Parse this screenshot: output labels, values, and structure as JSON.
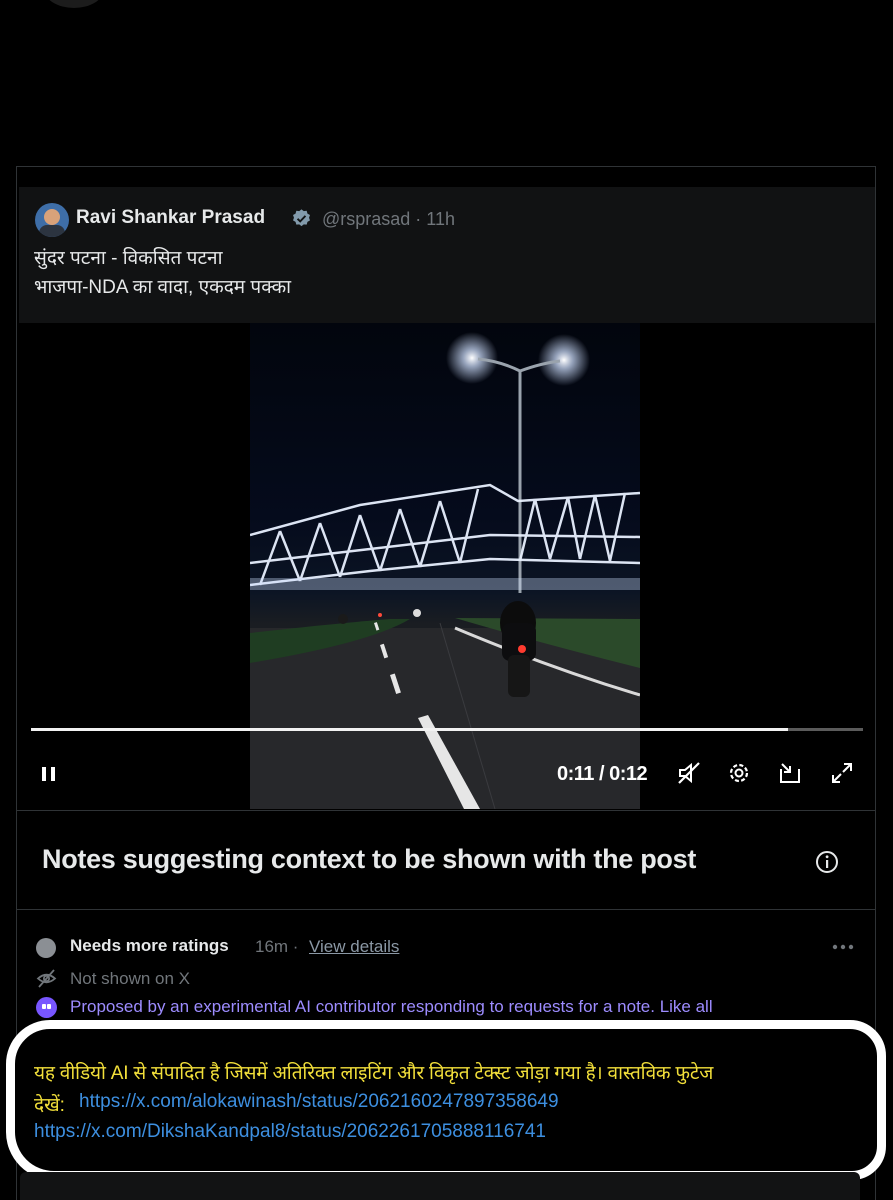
{
  "quote": {
    "author": "Ravi Shankar Prasad",
    "handle_time": "@rsprasad · 11h",
    "line1": "सुंदर पटना - विकसित पटना",
    "line2": "भाजपा-NDA का वादा, एकदम पक्का"
  },
  "video": {
    "time": "0:11 / 0:12",
    "progress": 0.91
  },
  "notes": {
    "title": "Notes suggesting context to be shown with the post",
    "status": "Needs more ratings",
    "status_time": "16m ·",
    "view_details": "View details",
    "not_shown": "Not shown on X",
    "ai_proposed": "Proposed by an experimental AI contributor responding to requests for a note. Like all",
    "note_text": "यह वीडियो AI से संपादित है जिसमें अतिरिक्त लाइटिंग और विकृत टेक्स्ट जोड़ा गया है। वास्तविक फुटेज",
    "note_prefix": "देखें:",
    "link1": "https://x.com/alokawinash/status/2062160247897358649",
    "link2": "https://x.com/DikshaKandpal8/status/2062261705888116741"
  },
  "colors": {
    "background": "#000000",
    "note_text": "#f2df3a",
    "link": "#3d8fe0",
    "ai_accent": "#7856ff"
  }
}
